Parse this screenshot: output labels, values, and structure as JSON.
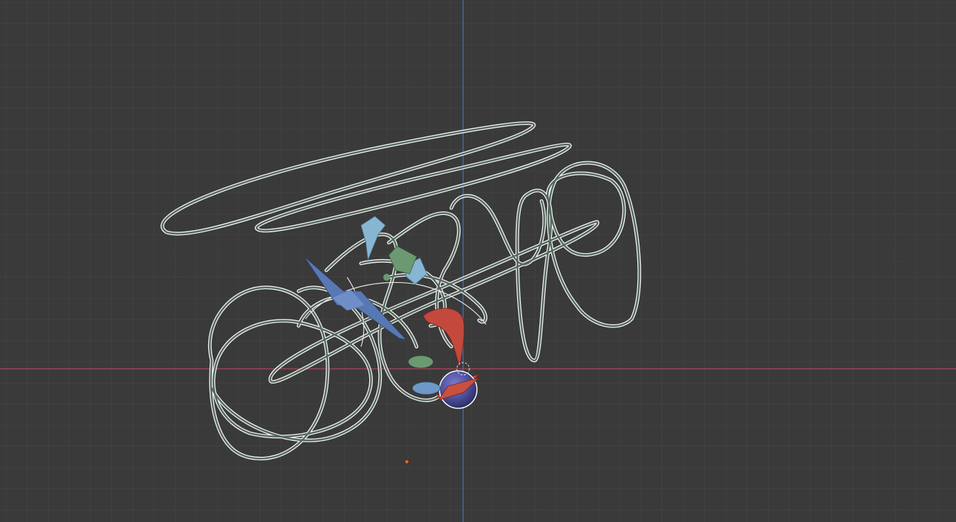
{
  "viewport": {
    "background": "#3a3a3a",
    "grid_color": "#474747",
    "x_axis_color": "#b3455a",
    "y_axis_color": "#4a72a8",
    "origin_marker_color": "#e0622a"
  },
  "scene": {
    "curve_object": {
      "stroke_outer": "#ffffff",
      "stroke_inner": "#56695f",
      "selected": true
    },
    "shapes": [
      {
        "name": "blue-ribbon-star",
        "color": "#5878b4"
      },
      {
        "name": "green-flag",
        "color": "#6b9a72"
      },
      {
        "name": "light-blue-ribbon",
        "color": "#86b6d2"
      },
      {
        "name": "red-curl",
        "color": "#c2493c"
      },
      {
        "name": "blue-sphere",
        "color": "#4e4f9c"
      },
      {
        "name": "green-blob",
        "color": "#6b9a72"
      },
      {
        "name": "blue-capsule",
        "color": "#6e98c8"
      }
    ]
  }
}
